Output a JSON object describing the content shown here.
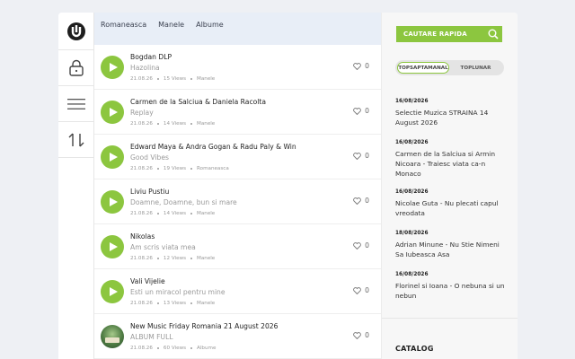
{
  "tabs": [
    "Romaneasca",
    "Manele",
    "Albume"
  ],
  "tracks": [
    {
      "artist": "Bogdan DLP",
      "title": "Hazolina",
      "date": "21.08.26",
      "views": "15 Views",
      "genre": "Manele",
      "likes": "0",
      "cover": false
    },
    {
      "artist": "Carmen de la Salciua & Daniela Racolta",
      "title": "Replay",
      "date": "21.08.26",
      "views": "14 Views",
      "genre": "Manele",
      "likes": "0",
      "cover": false
    },
    {
      "artist": "Edward Maya & Andra Gogan & Radu Paly & Win",
      "title": "Good Vibes",
      "date": "21.08.26",
      "views": "19 Views",
      "genre": "Romaneasca",
      "likes": "0",
      "cover": false
    },
    {
      "artist": "Liviu Pustiu",
      "title": "Doamne, Doamne, bun si mare",
      "date": "21.08.26",
      "views": "14 Views",
      "genre": "Manele",
      "likes": "0",
      "cover": false
    },
    {
      "artist": "Nikolas",
      "title": "Am scris viata mea",
      "date": "21.08.26",
      "views": "12 Views",
      "genre": "Manele",
      "likes": "0",
      "cover": false
    },
    {
      "artist": "Vali Vijelie",
      "title": "Esti un miracol pentru mine",
      "date": "21.08.26",
      "views": "13 Views",
      "genre": "Manele",
      "likes": "0",
      "cover": false
    },
    {
      "artist": "New Music Friday Romania 21 August 2026",
      "title": "ALBUM FULL",
      "date": "21.08.26",
      "views": "60 Views",
      "genre": "Albume",
      "likes": "0",
      "cover": true
    }
  ],
  "sidebar": {
    "search_label": "CAUTARE RAPIDA",
    "toggle_active": "TOPSAPTAMANAL",
    "toggle_inactive": "TOPLUNAR",
    "top": [
      {
        "date": "16/08/2026",
        "title": "Selectie Muzica STRAINA 14 August 2026"
      },
      {
        "date": "16/08/2026",
        "title": "Carmen de la Salciua si Armin Nicoara - Traiesc viata ca-n Monaco"
      },
      {
        "date": "16/08/2026",
        "title": "Nicolae Guta - Nu plecati capul vreodata"
      },
      {
        "date": "18/08/2026",
        "title": "Adrian Minune - Nu Stie Nimeni Sa Iubeasca Asa"
      },
      {
        "date": "16/08/2026",
        "title": "Florinel si Ioana - O nebuna si un nebun"
      }
    ],
    "catalog": "CATALOG"
  },
  "colors": {
    "accent": "#8cc63f",
    "tabs_bg": "#e8eef7",
    "page_bg": "#eef0f4"
  },
  "icons": {
    "nav": [
      "logo-icon",
      "lock-icon",
      "menu-icon",
      "sort-arrows-icon"
    ],
    "search": "search-icon",
    "play": "play-icon",
    "like": "heart-icon"
  }
}
